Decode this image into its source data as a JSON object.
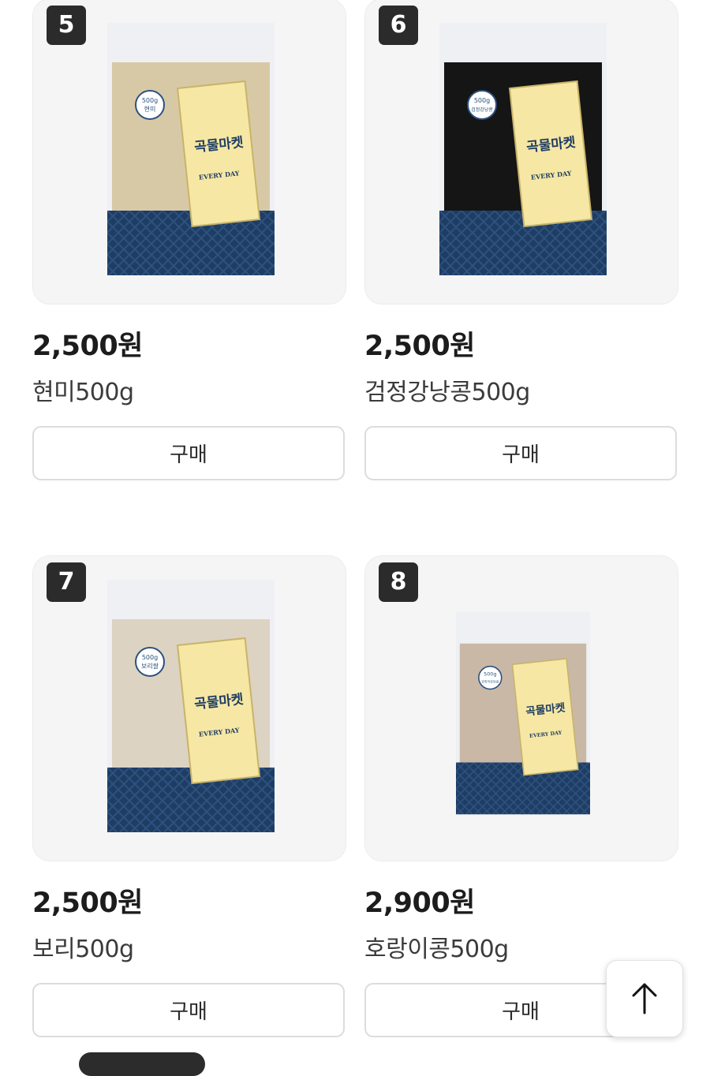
{
  "products": [
    {
      "rank": "5",
      "price": "2,500원",
      "name": "현미500g",
      "buy_label": "구매",
      "brand": "곡물마켓",
      "tag_line": "EVERY DAY",
      "badge_weight": "500g",
      "badge_name": "현미",
      "grain_color": "#d8c9a6"
    },
    {
      "rank": "6",
      "price": "2,500원",
      "name": "검정강낭콩500g",
      "buy_label": "구매",
      "brand": "곡물마켓",
      "tag_line": "EVERY DAY",
      "badge_weight": "500g",
      "badge_name": "검정강낭콩",
      "grain_color": "#151515"
    },
    {
      "rank": "7",
      "price": "2,500원",
      "name": "보리500g",
      "buy_label": "구매",
      "brand": "곡물마켓",
      "tag_line": "EVERY DAY",
      "badge_weight": "500g",
      "badge_name": "보리쌀",
      "grain_color": "#ddd3c2"
    },
    {
      "rank": "8",
      "price": "2,900원",
      "name": "호랑이콩500g",
      "buy_label": "구매",
      "brand": "곡물마켓",
      "tag_line": "EVERY DAY",
      "badge_weight": "500g",
      "badge_name": "호랑이강낭콩",
      "grain_color": "#c9b8a6"
    }
  ],
  "scroll_top": {
    "icon": "arrow-up-icon"
  },
  "colors": {
    "navy_pattern": "#1f3d63",
    "label_yellow": "#f6e7a4",
    "card_bg": "#f5f5f6"
  }
}
